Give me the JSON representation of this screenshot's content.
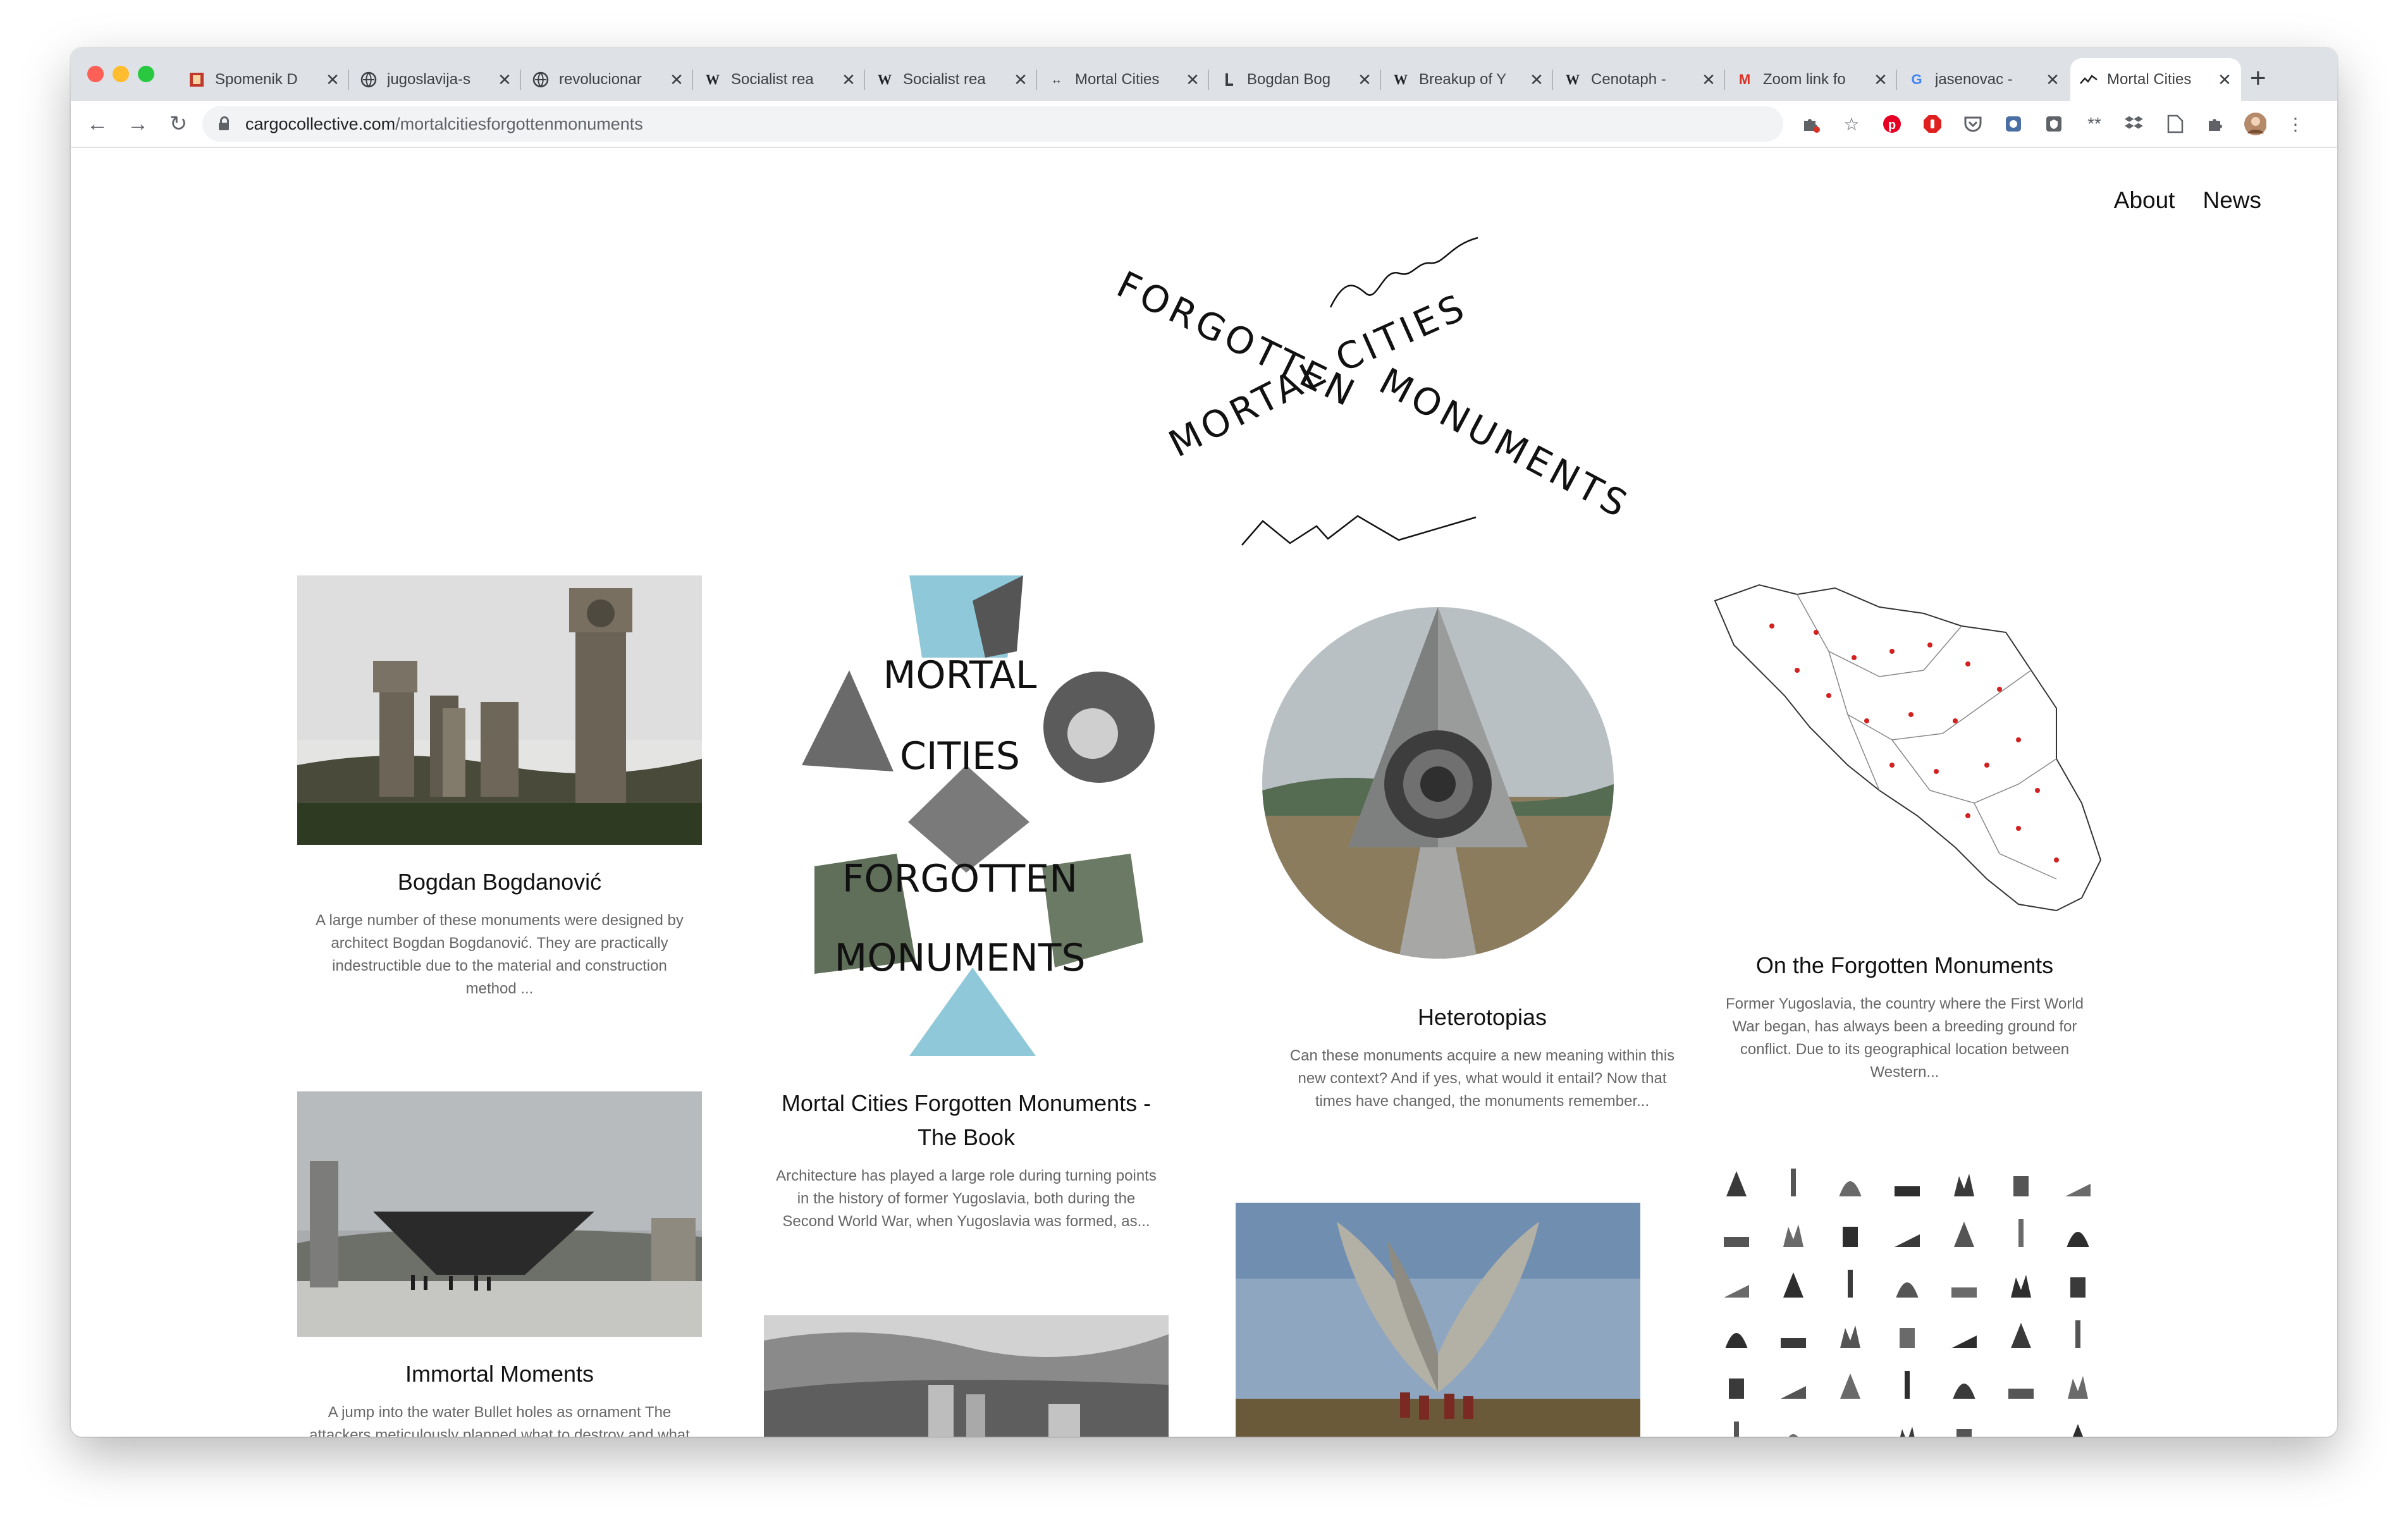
{
  "browser": {
    "tabs": [
      {
        "label": "Spomenik D",
        "icon": "spomenik-icon"
      },
      {
        "label": "jugoslavija-s",
        "icon": "globe-icon"
      },
      {
        "label": "revolucionar",
        "icon": "globe-icon"
      },
      {
        "label": "Socialist rea",
        "icon": "wikipedia-icon"
      },
      {
        "label": "Socialist rea",
        "icon": "wikipedia-icon"
      },
      {
        "label": "Mortal Cities",
        "icon": "cargo-icon"
      },
      {
        "label": "Bogdan Bog",
        "icon": "bookmark-icon"
      },
      {
        "label": "Breakup of Y",
        "icon": "wikipedia-icon"
      },
      {
        "label": "Cenotaph -",
        "icon": "wikipedia-icon"
      },
      {
        "label": "Zoom link fo",
        "icon": "gmail-icon"
      },
      {
        "label": "jasenovac -",
        "icon": "google-icon"
      },
      {
        "label": "Mortal Cities",
        "icon": "cargo-icon",
        "active": true
      }
    ],
    "url_host": "cargocollective.com",
    "url_path": "/mortalcitiesforgottenmonuments"
  },
  "nav": {
    "about": "About",
    "news": "News"
  },
  "logo": {
    "word1": "FORGOTTEN",
    "word2": "CITIES",
    "word3": "MORTAL",
    "word4": "MONUMENTS"
  },
  "book_cover": {
    "line1": "MORTAL",
    "line2": "CITIES",
    "line3": "FORGOTTEN",
    "line4": "MONUMENTS"
  },
  "projects": [
    {
      "title": "Bogdan Bogdanović",
      "description": "A large number of these monuments were designed by architect Bogdan Bogdanović. They are practically indestructible due to the material and construction method ..."
    },
    {
      "title": "Mortal Cities Forgotten Monuments - The Book",
      "description": "Architecture has played a large role during turning points in the history of former Yugoslavia, both during the Second World War, when Yugoslavia was formed, as..."
    },
    {
      "title": "Heterotopias",
      "description": "Can these monuments acquire a new meaning within this new context? And if yes, what would it entail? Now that times have changed, the monuments remember..."
    },
    {
      "title": "On the Forgotten Monuments",
      "description": "Former Yugoslavia, the country where the First World War began, has always been a breeding ground for conflict. Due to its geographical location between Western..."
    },
    {
      "title": "Immortal Moments",
      "description": "A jump into the water Bullet holes as ornament The attackers meticulously planned what to destroy and what"
    }
  ]
}
